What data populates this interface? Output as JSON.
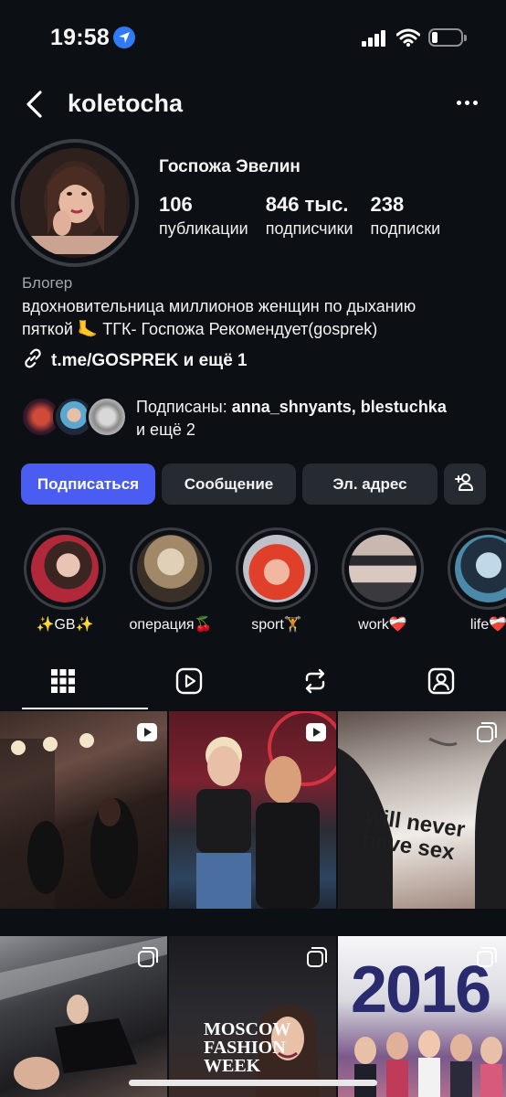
{
  "status_bar": {
    "time": "19:58"
  },
  "header": {
    "username": "koletocha"
  },
  "profile": {
    "display_name": "Госпожа Эвелин",
    "stats": [
      {
        "value": "106",
        "label": "публикации"
      },
      {
        "value": "846 тыс.",
        "label": "подписчики"
      },
      {
        "value": "238",
        "label": "подписки"
      }
    ],
    "category": "Блогер",
    "bio_line1": "вдохновительница миллионов женщин по дыханию",
    "bio_line2": "пяткой 🦶 ТГК- Госпожа Рекомендует(gosprek)",
    "link": "t.me/GOSPREK и ещё 1",
    "followed_by": {
      "prefix": "Подписаны: ",
      "users": "anna_shnyants, blestuchka",
      "suffix": "и ещё 2"
    }
  },
  "actions": {
    "follow": "Подписаться",
    "message": "Сообщение",
    "email": "Эл. адрес"
  },
  "highlights": [
    {
      "label": "✨GB✨"
    },
    {
      "label": "операция🍒"
    },
    {
      "label": "sport🏋"
    },
    {
      "label": "work❤️‍🩹"
    },
    {
      "label": "life❤️‍🩹"
    }
  ],
  "tabs": [
    "grid-icon",
    "reels-icon",
    "reposts-icon",
    "tagged-icon"
  ],
  "grid": {
    "post3_text": "will never have sex",
    "post5_text": "MOSCOW FASHION WEEK",
    "post6_text": "2016"
  },
  "colors": {
    "accent": "#4a5cf2",
    "background": "#0c0f14",
    "button": "#262a31"
  }
}
